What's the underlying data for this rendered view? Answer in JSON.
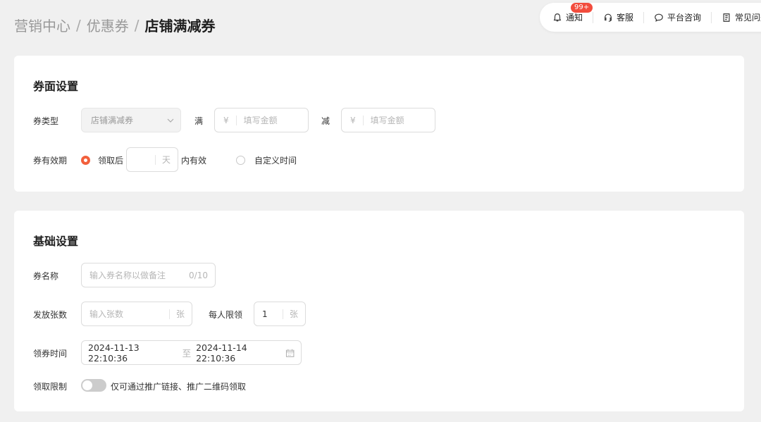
{
  "breadcrumb": {
    "items": [
      "营销中心",
      "优惠券"
    ],
    "current": "店铺满减券",
    "separator": "/"
  },
  "topnav": {
    "notice": {
      "label": "通知",
      "badge": "99+"
    },
    "service": {
      "label": "客服"
    },
    "consult": {
      "label": "平台咨询"
    },
    "faq": {
      "label": "常见问题"
    }
  },
  "coupon_face": {
    "title": "券面设置",
    "type_label": "券类型",
    "type_value": "店铺满减券",
    "full_label": "满",
    "full_prefix": "¥",
    "full_placeholder": "填写金额",
    "minus_label": "减",
    "minus_prefix": "¥",
    "minus_placeholder": "填写金额",
    "validity_label": "券有效期",
    "option_after": "领取后",
    "days_unit": "天",
    "valid_within": "内有效",
    "option_custom": "自定义时间"
  },
  "basic": {
    "title": "基础设置",
    "name_label": "券名称",
    "name_placeholder": "输入券名称以做备注",
    "name_counter": "0/10",
    "count_label": "发放张数",
    "count_placeholder": "输入张数",
    "count_unit": "张",
    "limit_label": "每人限领",
    "limit_value": "1",
    "limit_unit": "张",
    "time_label": "领券时间",
    "time_start": "2024-11-13 22:10:36",
    "time_sep": "至",
    "time_end": "2024-11-14 22:10:36",
    "restrict_label": "领取限制",
    "restrict_text": "仅可通过推广链接、推广二维码领取"
  },
  "colors": {
    "accent": "#f2603c",
    "badge": "#f24c3d",
    "background": "#f0f0f0"
  }
}
